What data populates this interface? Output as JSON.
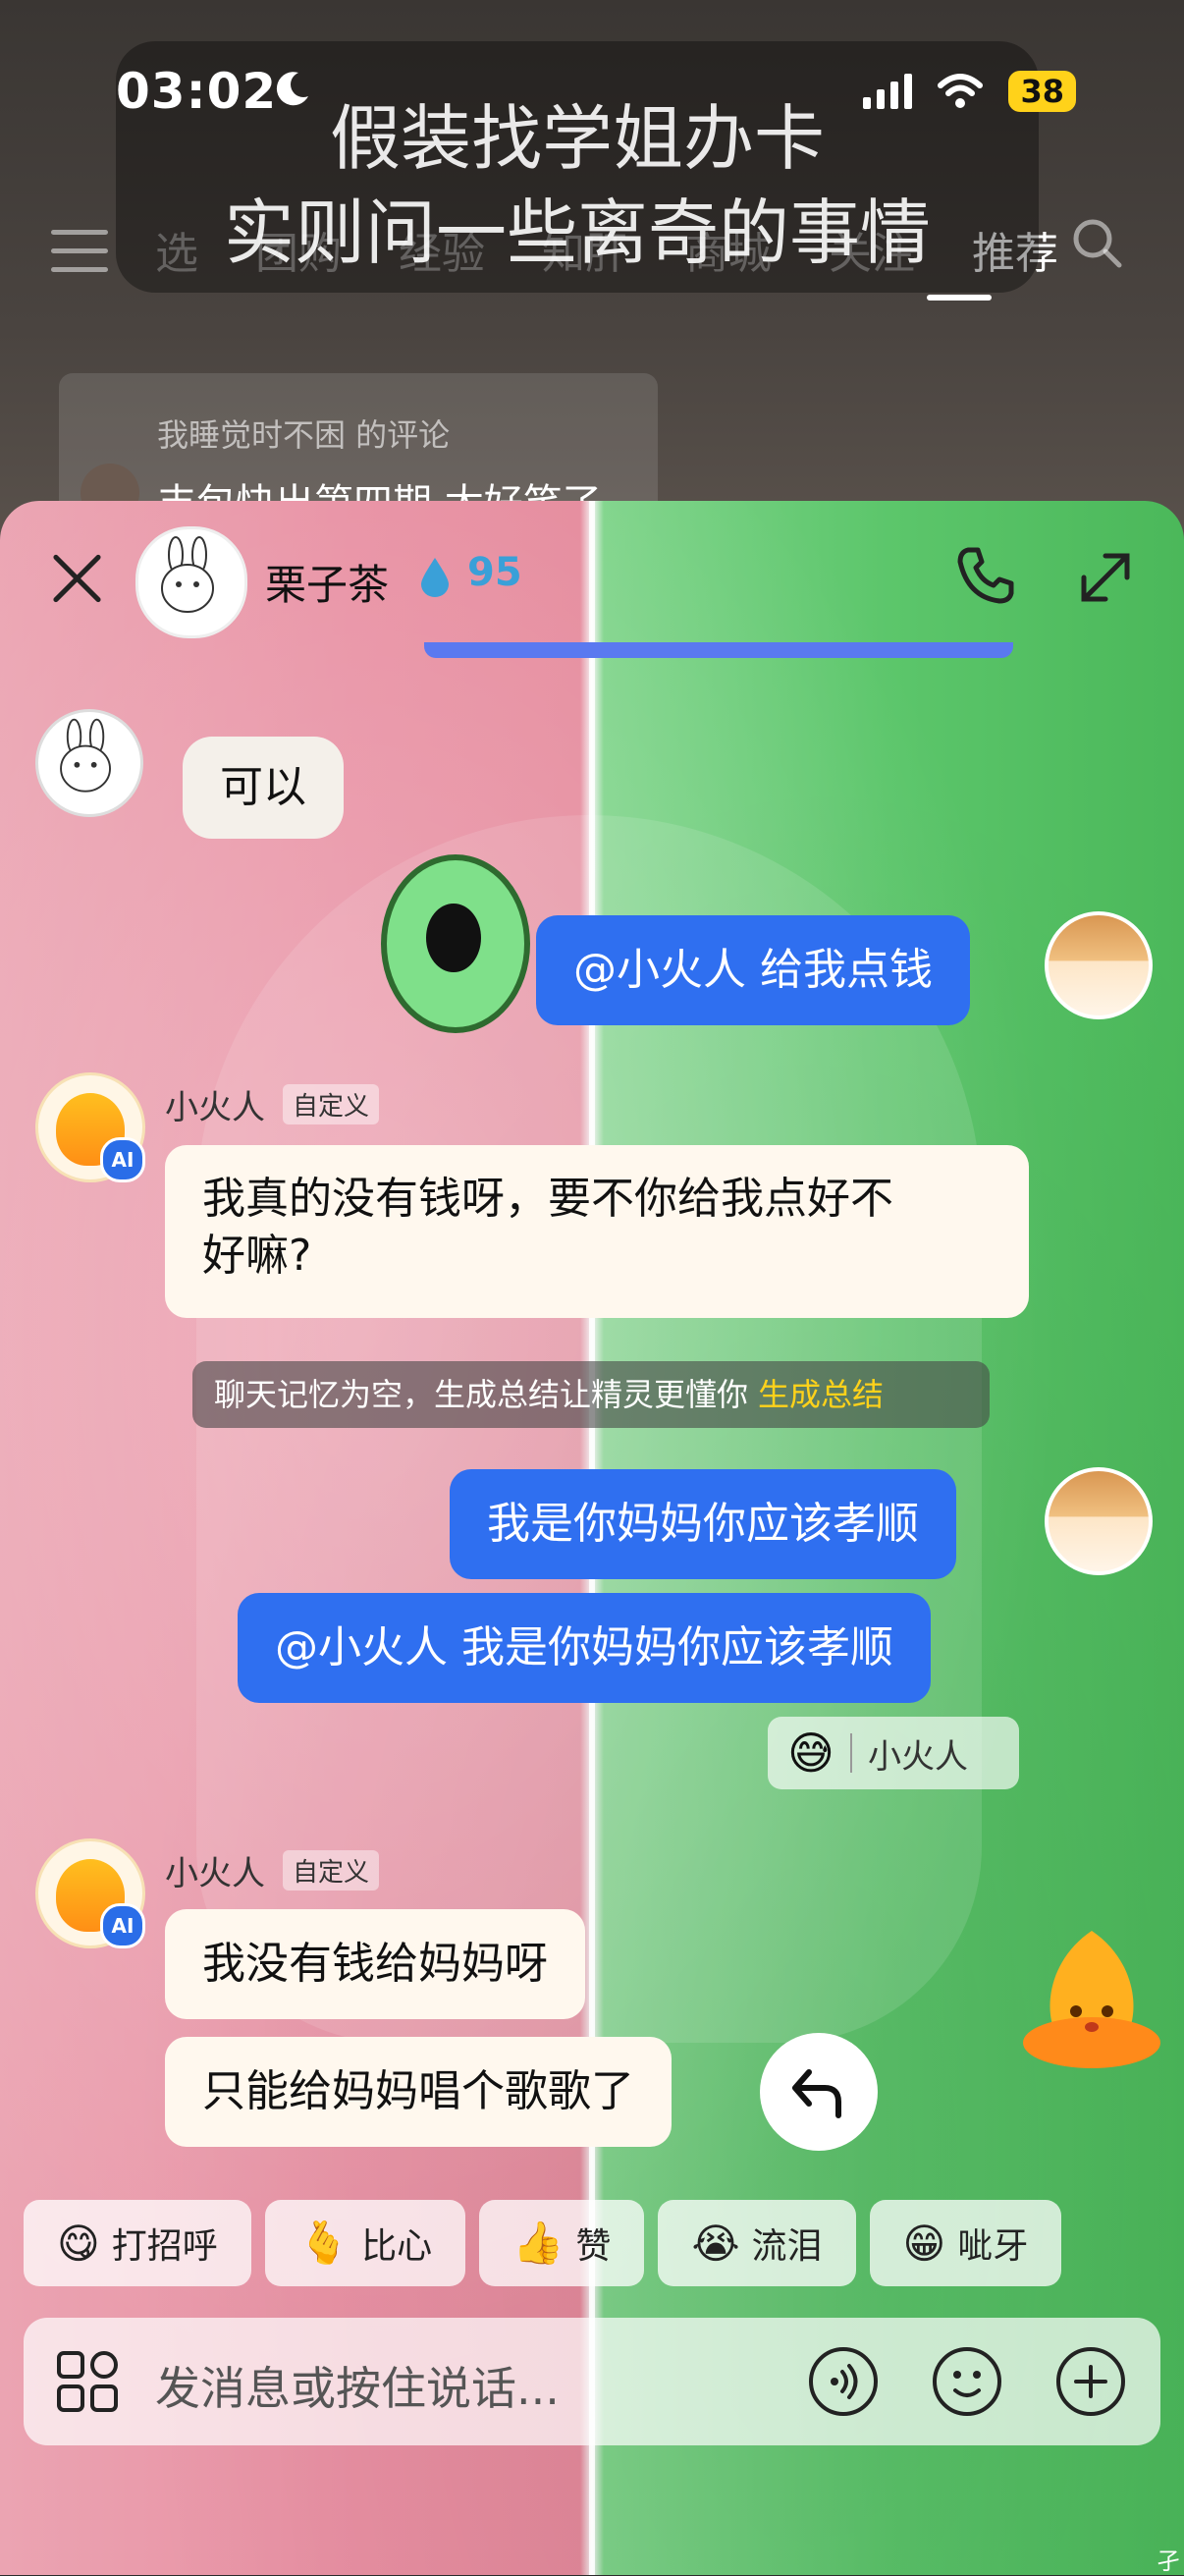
{
  "status_bar": {
    "time": "03:02",
    "battery": "38"
  },
  "overlay_caption": {
    "line1": "假装找学姐办卡",
    "line2": "实则问一些离奇的事情"
  },
  "background_tabs": [
    "选",
    "团购",
    "经验",
    "知肝",
    "商城",
    "关注",
    "推荐"
  ],
  "background_comment": {
    "who": "我睡觉时不困 的评论",
    "text": "丰包快出第四期 太好笑了"
  },
  "chat_header": {
    "name": "栗子茶",
    "score": "95"
  },
  "messages": {
    "m1_text": "可以",
    "m2_text": "@小火人 给我点钱",
    "m3_sender": "小火人",
    "m3_tag": "自定义",
    "m3_line1": "我真的没有钱呀，要不你给我点好不",
    "m3_line2": "好嘛?",
    "system_text": "聊天记忆为空，生成总结让精灵更懂你",
    "system_link": "生成总结",
    "m4_text": "我是你妈妈你应该孝顺",
    "m5_text": "@小火人 我是你妈妈你应该孝顺",
    "reaction_emoji": "😅",
    "reaction_label": "小火人",
    "m6_sender": "小火人",
    "m6_tag": "自定义",
    "m6_line1": "我没有钱给妈妈呀",
    "m6_line2": "只能给妈妈唱个歌歌了"
  },
  "ai_badge": "AI",
  "quick_replies": [
    {
      "emoji": "😋",
      "label": "打招呼"
    },
    {
      "emoji": "🫰",
      "label": "比心"
    },
    {
      "emoji": "👍",
      "label": "赞"
    },
    {
      "emoji": "😭",
      "label": "流泪"
    },
    {
      "emoji": "😁",
      "label": "呲牙"
    }
  ],
  "input": {
    "placeholder": "发消息或按住说话..."
  },
  "corner_char": "孑",
  "colors": {
    "outgoing_bubble": "#2f6ff0",
    "incoming_bubble": "#fff8ee",
    "link": "#ffd21a",
    "ai_badge": "#2a6de8"
  },
  "icons": [
    "moon-icon",
    "signal-icon",
    "wifi-icon",
    "close-icon",
    "water-drop-icon",
    "phone-icon",
    "expand-icon",
    "reply-icon",
    "apps-grid-icon",
    "voice-icon",
    "emoji-icon",
    "plus-icon",
    "search-icon",
    "menu-icon"
  ]
}
